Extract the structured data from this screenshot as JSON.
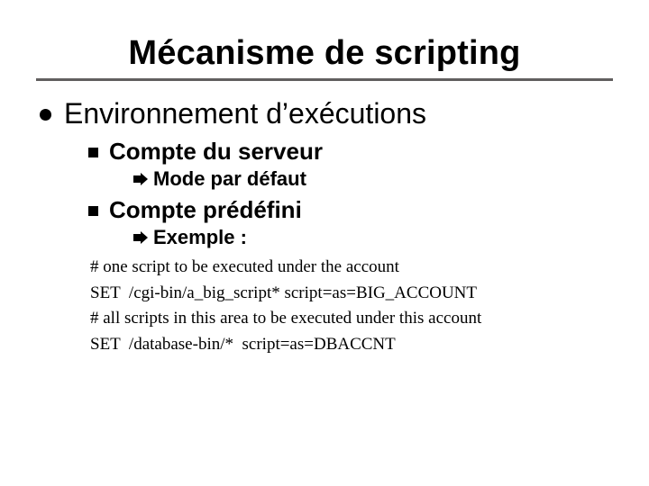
{
  "title": "Mécanisme de scripting",
  "lvl1": {
    "text": "Environnement d’exécutions"
  },
  "lvl2a": {
    "text": "Compte du serveur"
  },
  "lvl3a": {
    "text": "Mode par défaut"
  },
  "lvl2b": {
    "text": "Compte prédéfini"
  },
  "lvl3b": {
    "text": "Exemple :"
  },
  "code": {
    "l1": "# one script to be executed under the account",
    "l2": "SET  /cgi-bin/a_big_script* script=as=BIG_ACCOUNT",
    "l3": "# all scripts in this area to be executed under this account",
    "l4": "SET  /database-bin/*  script=as=DBACCNT"
  }
}
